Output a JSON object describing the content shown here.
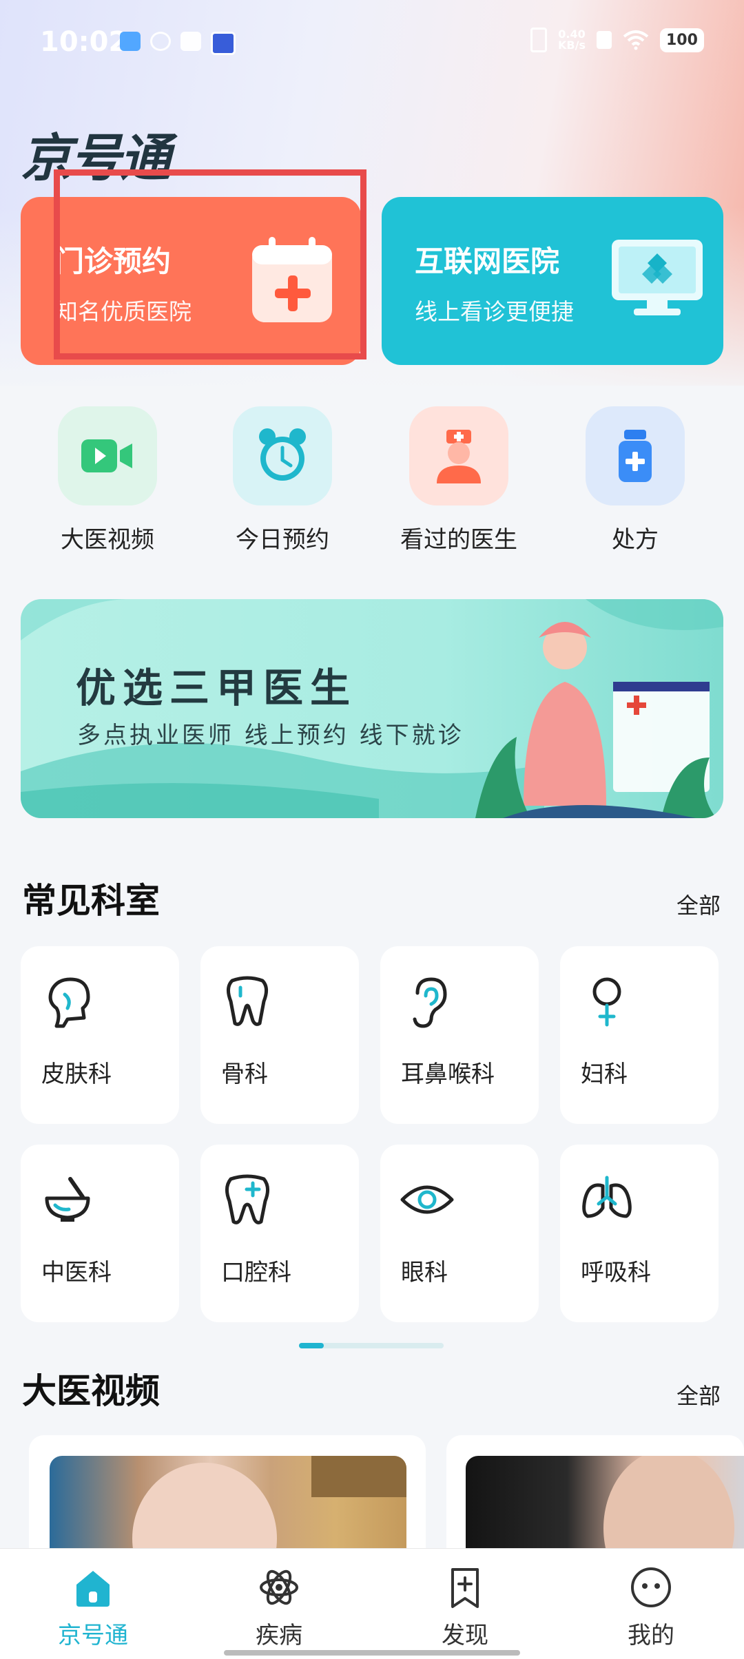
{
  "status_bar": {
    "time": "10:02",
    "net_speed_value": "0.40",
    "net_speed_unit": "KB/s",
    "battery": "100"
  },
  "app": {
    "logo_text": "京号通"
  },
  "top_cards": [
    {
      "title": "门诊预约",
      "subtitle": "知名优质医院",
      "color": "#ff7458"
    },
    {
      "title": "互联网医院",
      "subtitle": "线上看诊更便捷",
      "color": "#20c2d6"
    }
  ],
  "quick_items": [
    {
      "label": "大医视频",
      "icon": "video-camera-icon"
    },
    {
      "label": "今日预约",
      "icon": "alarm-clock-icon"
    },
    {
      "label": "看过的医生",
      "icon": "nurse-icon"
    },
    {
      "label": "处方",
      "icon": "medicine-bottle-icon"
    }
  ],
  "banner": {
    "title": "优选三甲医生",
    "subtitle": "多点执业医师 线上预约 线下就诊"
  },
  "departments_section": {
    "title": "常见科室",
    "more": "全部",
    "items": [
      {
        "label": "皮肤科",
        "icon": "head-profile-icon"
      },
      {
        "label": "骨科",
        "icon": "tooth-bone-icon"
      },
      {
        "label": "耳鼻喉科",
        "icon": "ear-icon"
      },
      {
        "label": "妇科",
        "icon": "female-symbol-icon"
      },
      {
        "label": "中医科",
        "icon": "mortar-pestle-icon"
      },
      {
        "label": "口腔科",
        "icon": "tooth-plus-icon"
      },
      {
        "label": "眼科",
        "icon": "eye-icon"
      },
      {
        "label": "呼吸科",
        "icon": "lungs-icon"
      }
    ]
  },
  "videos_section": {
    "title": "大医视频",
    "more": "全部"
  },
  "tabbar": {
    "items": [
      {
        "label": "京号通",
        "icon": "home-icon",
        "active": true
      },
      {
        "label": "疾病",
        "icon": "atom-icon",
        "active": false
      },
      {
        "label": "发现",
        "icon": "bookmark-plus-icon",
        "active": false
      },
      {
        "label": "我的",
        "icon": "smiley-icon",
        "active": false
      }
    ]
  },
  "colors": {
    "accent": "#20b4d0",
    "appointment_card": "#ff7458",
    "internet_card": "#20c2d6",
    "highlight_box": "#e84b4b"
  }
}
